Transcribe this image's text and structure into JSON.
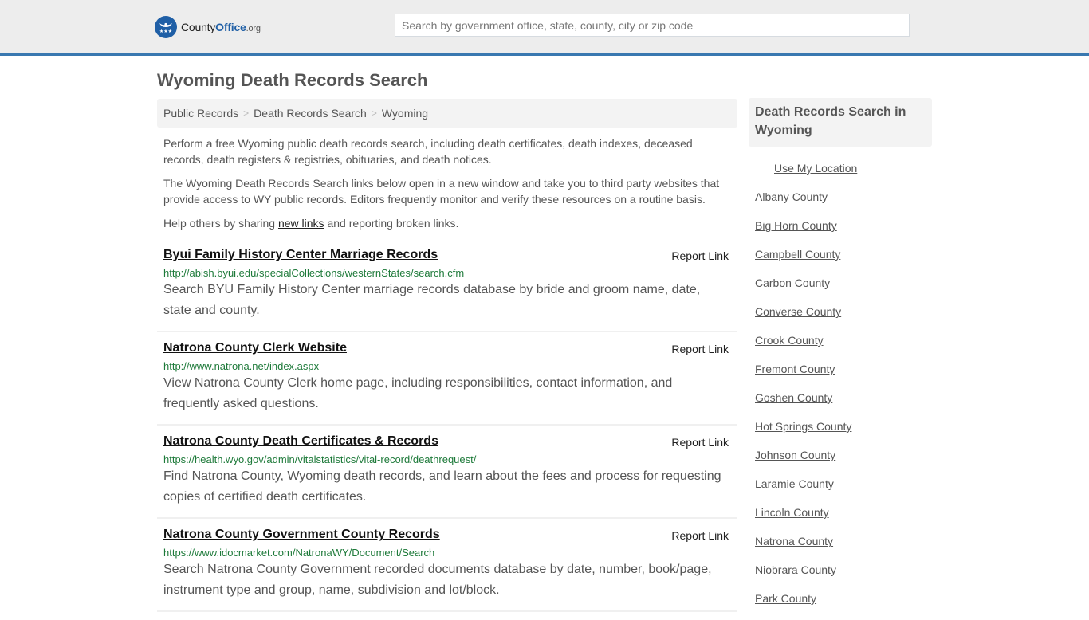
{
  "header": {
    "logo": {
      "county": "County",
      "office": "Office",
      "org": ".org"
    },
    "search_placeholder": "Search by government office, state, county, city or zip code"
  },
  "page_title": "Wyoming Death Records Search",
  "breadcrumb": [
    "Public Records",
    "Death Records Search",
    "Wyoming"
  ],
  "intro": {
    "p1": "Perform a free Wyoming public death records search, including death certificates, death indexes, deceased records, death registers & registries, obituaries, and death notices.",
    "p2": "The Wyoming Death Records Search links below open in a new window and take you to third party websites that provide access to WY public records. Editors frequently monitor and verify these resources on a routine basis.",
    "p3_before": "Help others by sharing ",
    "p3_link": "new links",
    "p3_after": " and reporting broken links."
  },
  "report_label": "Report Link",
  "results": [
    {
      "title": "Byui Family History Center Marriage Records",
      "url": "http://abish.byui.edu/specialCollections/westernStates/search.cfm",
      "desc": "Search BYU Family History Center marriage records database by bride and groom name, date, state and county."
    },
    {
      "title": "Natrona County Clerk Website",
      "url": "http://www.natrona.net/index.aspx",
      "desc": "View Natrona County Clerk home page, including responsibilities, contact information, and frequently asked questions."
    },
    {
      "title": "Natrona County Death Certificates & Records",
      "url": "https://health.wyo.gov/admin/vitalstatistics/vital-record/deathrequest/",
      "desc": "Find Natrona County, Wyoming death records, and learn about the fees and process for requesting copies of certified death certificates."
    },
    {
      "title": "Natrona County Government County Records",
      "url": "https://www.idocmarket.com/NatronaWY/Document/Search",
      "desc": "Search Natrona County Government recorded documents database by date, number, book/page, instrument type and group, name, subdivision and lot/block."
    }
  ],
  "sidebar": {
    "title": "Death Records Search in Wyoming",
    "use_location": "Use My Location",
    "counties": [
      "Albany County",
      "Big Horn County",
      "Campbell County",
      "Carbon County",
      "Converse County",
      "Crook County",
      "Fremont County",
      "Goshen County",
      "Hot Springs County",
      "Johnson County",
      "Laramie County",
      "Lincoln County",
      "Natrona County",
      "Niobrara County",
      "Park County"
    ]
  }
}
